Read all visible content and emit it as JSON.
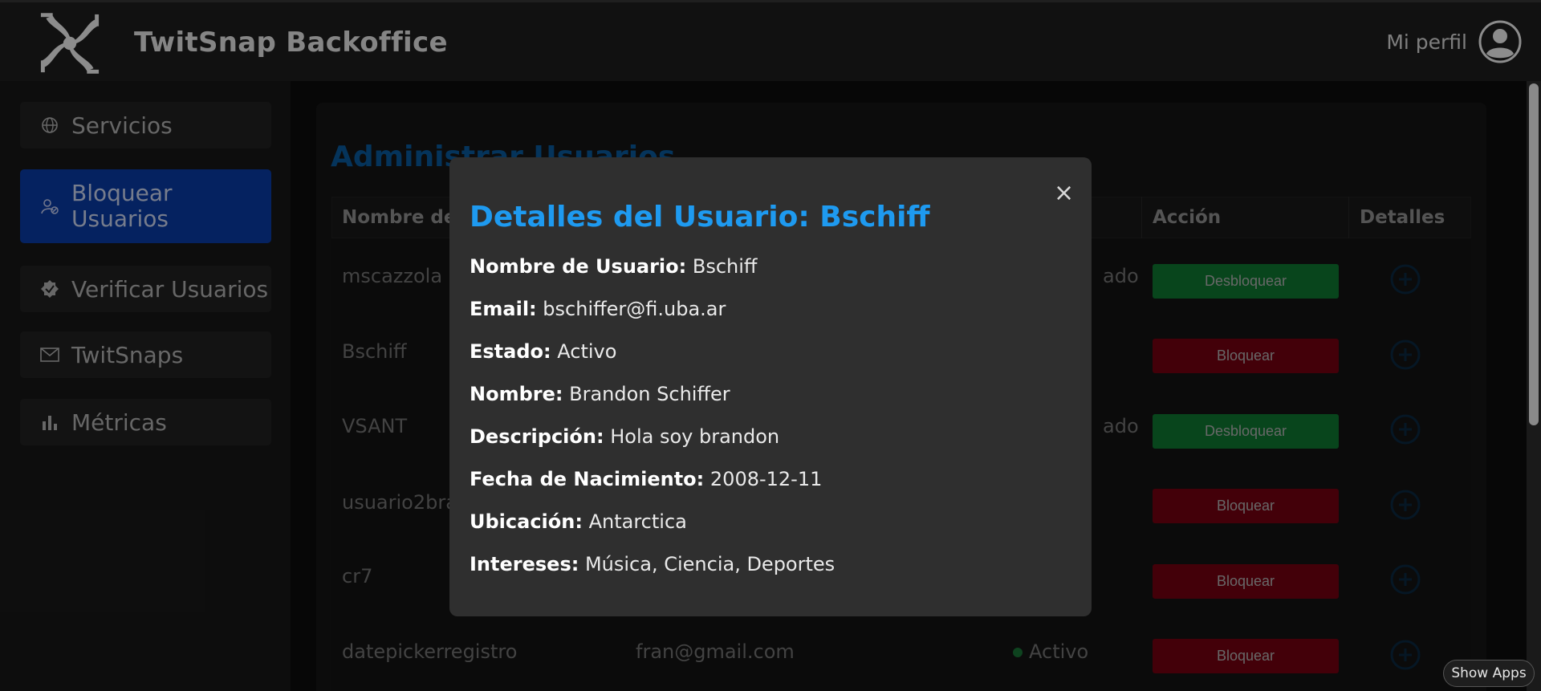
{
  "header": {
    "title": "TwitSnap Backoffice",
    "profile_label": "Mi perfil"
  },
  "sidebar": {
    "items": [
      {
        "label": "Servicios",
        "icon": "globe-icon"
      },
      {
        "label": "Bloquear Usuarios",
        "icon": "user-block-icon"
      },
      {
        "label": "Verificar Usuarios",
        "icon": "verified-badge-icon"
      },
      {
        "label": "TwitSnaps",
        "icon": "envelope-icon"
      },
      {
        "label": "Métricas",
        "icon": "bar-chart-icon"
      }
    ]
  },
  "main": {
    "title": "Administrar Usuarios",
    "table": {
      "headers": [
        "Nombre de",
        "Acción",
        "Detalles"
      ],
      "rows": [
        {
          "username": "mscazzola",
          "status_fragment": "ado",
          "action": "Desbloquear"
        },
        {
          "username": "Bschiff",
          "status_fragment": "",
          "action": "Bloquear"
        },
        {
          "username": "VSANT",
          "status_fragment": "ado",
          "action": "Desbloquear"
        },
        {
          "username": "usuario2bra",
          "status_fragment": "",
          "action": "Bloquear"
        },
        {
          "username": "cr7",
          "status_fragment": "",
          "action": "Bloquear"
        },
        {
          "username": "datepickerregistro",
          "email": "fran@gmail.com",
          "status": "Activo",
          "action": "Bloquear"
        }
      ]
    }
  },
  "modal": {
    "title": "Detalles del Usuario: Bschiff",
    "close": "×",
    "fields": [
      {
        "label": "Nombre de Usuario:",
        "value": "Bschiff"
      },
      {
        "label": "Email:",
        "value": "bschiffer@fi.uba.ar"
      },
      {
        "label": "Estado:",
        "value": "Activo"
      },
      {
        "label": "Nombre:",
        "value": "Brandon Schiffer"
      },
      {
        "label": "Descripción:",
        "value": "Hola soy brandon"
      },
      {
        "label": "Fecha de Nacimiento:",
        "value": "2008-12-11"
      },
      {
        "label": "Ubicación:",
        "value": "Antarctica"
      },
      {
        "label": "Intereses:",
        "value": "Música, Ciencia, Deportes"
      }
    ]
  },
  "taskbar": {
    "show_apps": "Show Apps"
  },
  "colors": {
    "accent_blue": "#1e9af0",
    "active_sidebar": "#0a3fb0",
    "unblock_green": "#0f7f34",
    "block_red": "#7a0012"
  }
}
